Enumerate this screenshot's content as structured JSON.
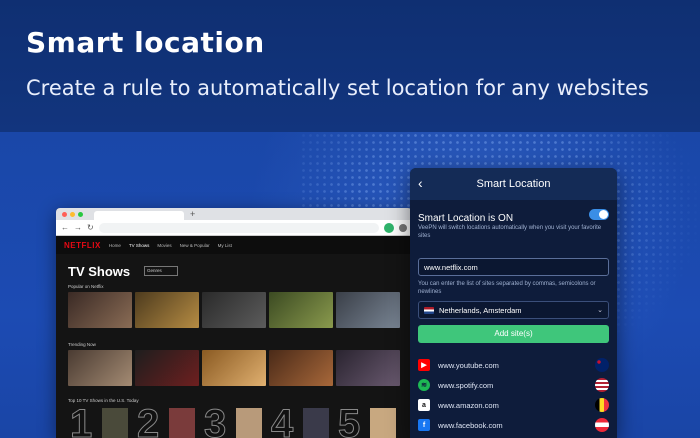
{
  "hero": {
    "title": "Smart  location",
    "subtitle": "Create a rule to automatically set location for any websites"
  },
  "browser": {
    "logo": "NETFLIX",
    "nav_links": [
      "Home",
      "TV Shows",
      "Movies",
      "New & Popular",
      "My List"
    ],
    "page_title": "TV Shows",
    "genre_select": "Genres",
    "rows": [
      "Popular on Netflix",
      "Trending Now",
      "Top 10 TV Shows in the U.S. Today"
    ]
  },
  "vpn": {
    "header_title": "Smart Location",
    "back_icon": "chevron-left-icon",
    "toggle_label": "Smart Location is ON",
    "toggle_state": "on",
    "description": "VeePN will switch locations automatically when you visit your favorite sites",
    "input_value": "www.netflix.com",
    "input_hint": "You can enter the list of sites separated by commas, semicolons or newlines",
    "location": "Netherlands, Amsterdam",
    "add_button": "Add site(s)",
    "sites": [
      {
        "name": "www.youtube.com",
        "icon": "youtube-icon",
        "flag": "australia-flag-icon"
      },
      {
        "name": "www.spotify.com",
        "icon": "spotify-icon",
        "flag": "usa-flag-icon"
      },
      {
        "name": "www.amazon.com",
        "icon": "amazon-icon",
        "flag": "belgium-flag-icon"
      },
      {
        "name": "www.facebook.com",
        "icon": "facebook-icon",
        "flag": "austria-flag-icon"
      }
    ]
  },
  "colors": {
    "accent_green": "#3fc67b",
    "toggle_blue": "#3a8ee6",
    "netflix_red": "#e50914",
    "background_blue": "#123c8c"
  }
}
